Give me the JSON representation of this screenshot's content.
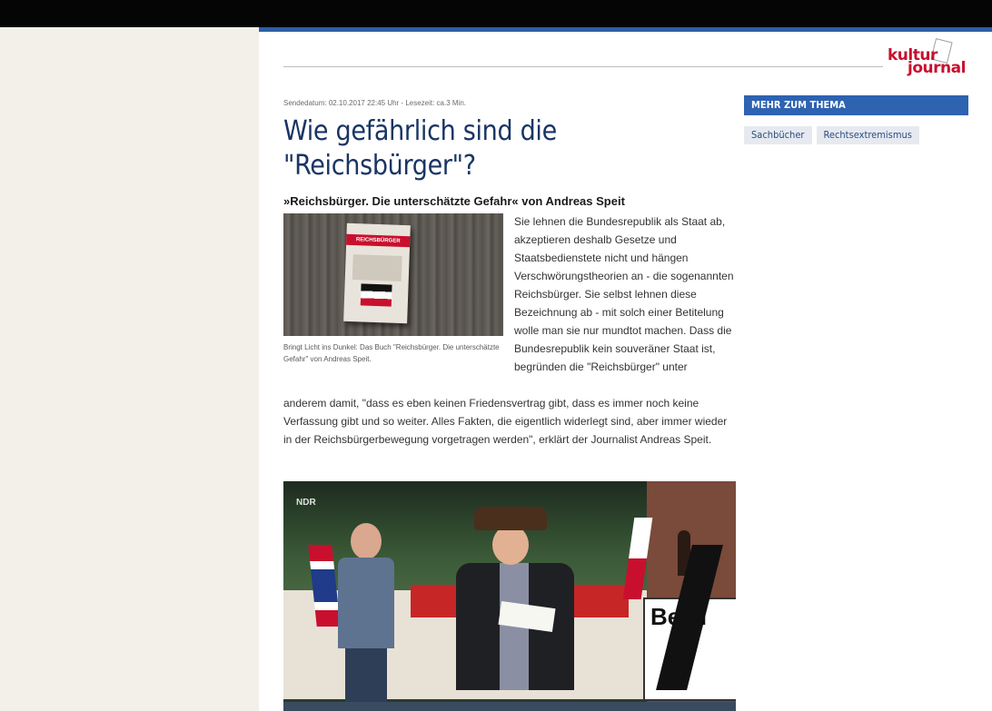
{
  "logo": {
    "line1": "kultur",
    "line2": "journal"
  },
  "article": {
    "meta": "Sendedatum: 02.10.2017 22:45 Uhr - Lesezeit: ca.3 Min.",
    "headline_line1": "Wie gefährlich sind die",
    "headline_line2": "\"Reichsbürger\"?",
    "subheading": "»Reichsbürger. Die unterschätzte Gefahr« von Andreas Speit",
    "image": {
      "book_band_text": "REICHSBÜRGER",
      "caption": "Bringt Licht ins Dunkel: Das Buch \"Reichsbürger. Die unterschätzte Gefahr\" von Andreas Speit."
    },
    "paragraph_right": "Sie lehnen die Bundesrepublik als Staat ab, akzeptieren deshalb Gesetze und Staatsbedienstete nicht und hängen Verschwörungstheorien an - die sogenannten Reichsbürger. Sie selbst lehnen diese Bezeichnung ab - mit solch einer Betitelung wolle man sie nur mundtot machen. Dass die Bundesrepublik kein souveräner Staat ist, begründen die \"Reichsbürger\" unter",
    "paragraph_full": "anderem damit, \"dass es eben keinen Friedensvertrag gibt, dass es immer noch keine Verfassung gibt und so weiter. Alles Fakten, die eigentlich widerlegt sind, aber immer wieder in der Reichsbürgerbewegung vorgetragen werden\", erklärt der Journalist Andreas Speit.",
    "video": {
      "watermark": "NDR",
      "sign_text": "Be ei"
    }
  },
  "sidebar": {
    "header": "MEHR ZUM THEMA",
    "tags": [
      "Sachbücher",
      "Rechtsextremismus"
    ]
  },
  "colors": {
    "accent_blue": "#2d5fa5",
    "headline_blue": "#1a3564",
    "brand_red": "#c8102e"
  }
}
